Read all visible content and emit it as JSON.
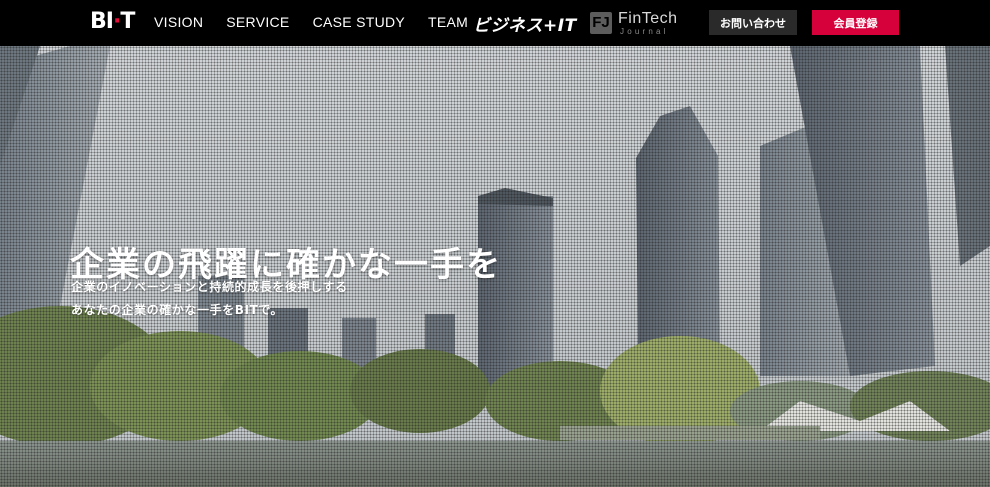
{
  "header": {
    "logo": {
      "text_before": "BI",
      "text_accent": "·",
      "text_after": "T"
    },
    "nav": [
      {
        "label": "VISION"
      },
      {
        "label": "SERVICE"
      },
      {
        "label": "CASE STUDY"
      },
      {
        "label": "TEAM"
      }
    ],
    "brand_bizit": "ビジネス+IT",
    "brand_fintech": {
      "mark": "FJ",
      "name": "FinTech",
      "sub": "Journal"
    },
    "contact_button": "お問い合わせ",
    "register_button": "会員登録"
  },
  "hero": {
    "title": "企業の飛躍に確かな一手を",
    "subtitle_line1": "企業のイノベーションと持続的成長を後押しする",
    "subtitle_line2": "あなたの企業の確かな一手をBITで。"
  },
  "colors": {
    "header_bg": "#000000",
    "accent_red": "#d6003a",
    "contact_bg": "#2a2a2a"
  }
}
